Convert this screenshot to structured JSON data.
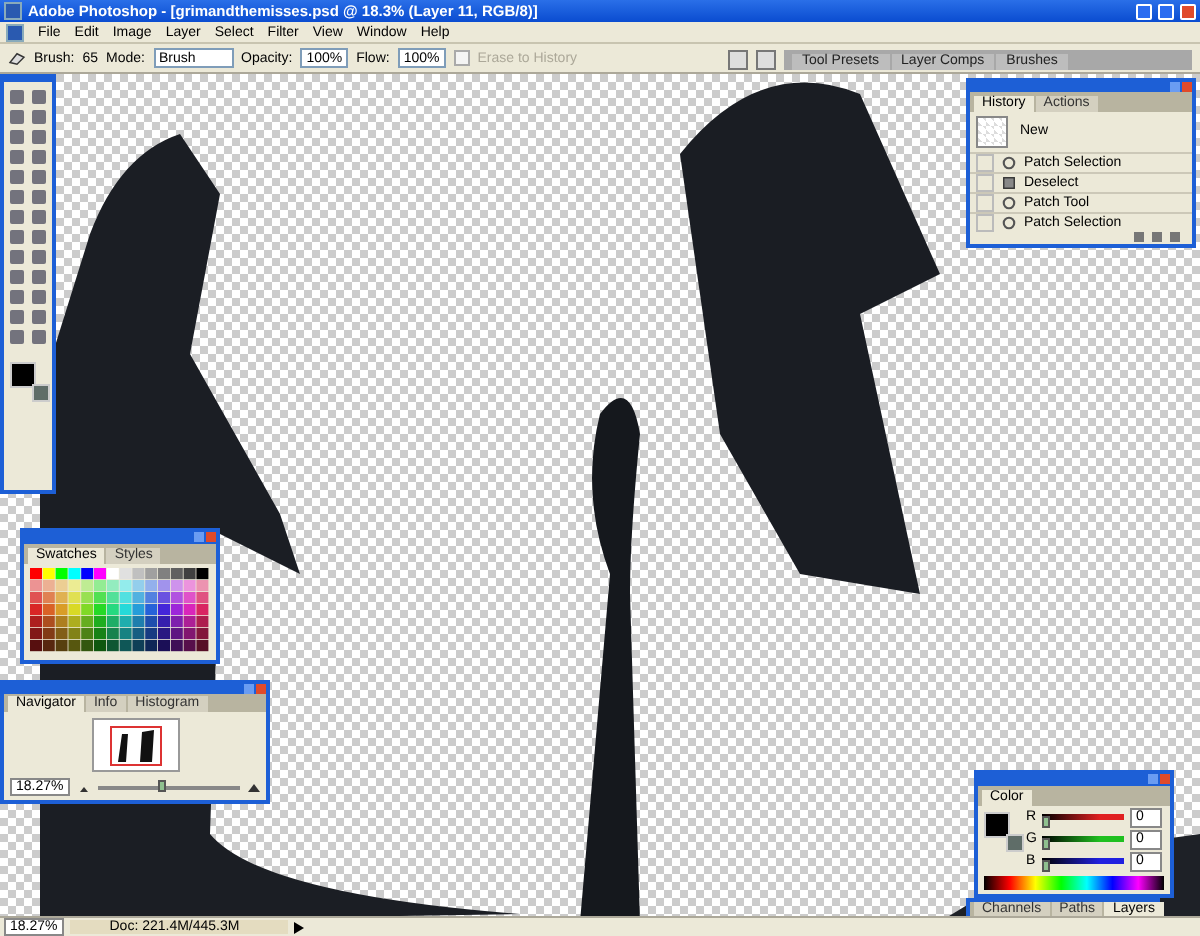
{
  "window": {
    "title": "Adobe Photoshop - [grimandthemisses.psd @ 18.3% (Layer 11, RGB/8)]"
  },
  "menu": [
    "File",
    "Edit",
    "Image",
    "Layer",
    "Select",
    "Filter",
    "View",
    "Window",
    "Help"
  ],
  "options_bar": {
    "brush_label": "Brush:",
    "brush_size": "65",
    "mode_label": "Mode:",
    "mode": "Brush",
    "opacity_label": "Opacity:",
    "opacity": "100%",
    "flow_label": "Flow:",
    "flow": "100%",
    "erase_to_history": {
      "label": "Erase to History",
      "checked": false,
      "disabled": true
    }
  },
  "palette_well": {
    "tabs": [
      {
        "label": "Tool Presets"
      },
      {
        "label": "Layer Comps"
      },
      {
        "label": "Brushes"
      }
    ]
  },
  "history": {
    "tabs": [
      {
        "label": "History",
        "selected": true
      },
      {
        "label": "Actions",
        "selected": false
      }
    ],
    "snapshot": "New",
    "items": [
      {
        "label": "Patch Selection",
        "kind": "patch"
      },
      {
        "label": "Deselect",
        "kind": "deselect"
      },
      {
        "label": "Patch Tool",
        "kind": "patch"
      },
      {
        "label": "Patch Selection",
        "kind": "patch"
      }
    ]
  },
  "swatches": {
    "tabs": [
      {
        "label": "Swatches",
        "selected": true
      },
      {
        "label": "Styles",
        "selected": false
      }
    ]
  },
  "navigator": {
    "tabs": [
      {
        "label": "Navigator",
        "selected": true
      },
      {
        "label": "Info",
        "selected": false
      },
      {
        "label": "Histogram",
        "selected": false
      }
    ],
    "zoom": "18.27%",
    "level": 0.45
  },
  "color": {
    "tabs": [
      {
        "label": "Color",
        "selected": true
      }
    ],
    "channels": [
      {
        "label": "R",
        "value": "0",
        "level": 0,
        "color": "#e02020"
      },
      {
        "label": "G",
        "value": "0",
        "level": 0,
        "color": "#20c020"
      },
      {
        "label": "B",
        "value": "0",
        "level": 0,
        "color": "#2020e0"
      }
    ]
  },
  "layers": {
    "tabs": [
      {
        "label": "Channels",
        "selected": false
      },
      {
        "label": "Paths",
        "selected": false
      },
      {
        "label": "Layers",
        "selected": true
      }
    ]
  },
  "status_bar": {
    "zoom": "18.27%",
    "doc": "Doc: 221.4M/445.3M"
  }
}
